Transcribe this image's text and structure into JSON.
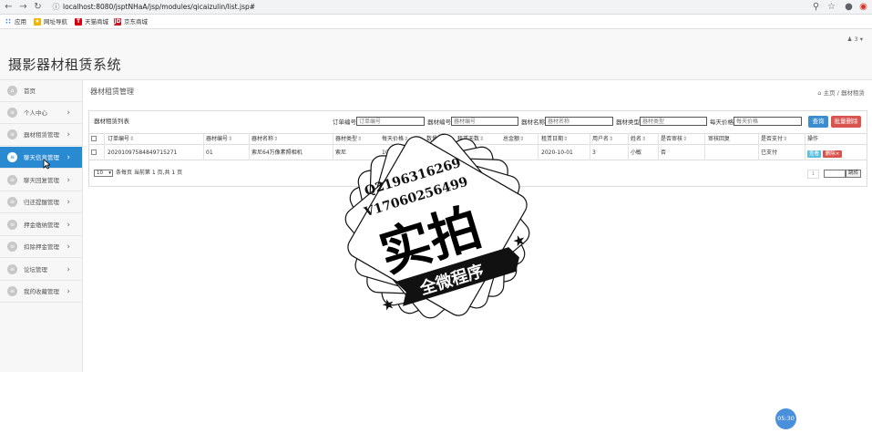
{
  "browser": {
    "url": "localhost:8080/jsptNHaA/jsp/modules/qicaizulin/list.jsp#",
    "bookmarks": [
      {
        "label": "应用",
        "icon": "apps-grid-icon"
      },
      {
        "label": "网址导航",
        "icon": "star-folder-icon"
      },
      {
        "label": "天猫商城",
        "icon": "tmall-icon"
      },
      {
        "label": "京东商城",
        "icon": "jd-icon"
      }
    ]
  },
  "header": {
    "app_title": "摄影器材租赁系统",
    "user_menu": "3"
  },
  "sidebar": {
    "items": [
      {
        "label": "首页",
        "active": false,
        "chevron": false
      },
      {
        "label": "个人中心",
        "active": false,
        "chevron": true
      },
      {
        "label": "器材租赁管理",
        "active": false,
        "chevron": true
      },
      {
        "label": "聊天信息管理",
        "active": true,
        "chevron": true
      },
      {
        "label": "聊天回复管理",
        "active": false,
        "chevron": true
      },
      {
        "label": "归还提醒管理",
        "active": false,
        "chevron": true
      },
      {
        "label": "押金缴纳管理",
        "active": false,
        "chevron": true
      },
      {
        "label": "扣除押金管理",
        "active": false,
        "chevron": true
      },
      {
        "label": "论坛管理",
        "active": false,
        "chevron": true
      },
      {
        "label": "我的收藏管理",
        "active": false,
        "chevron": true
      }
    ]
  },
  "main": {
    "heading": "器材租赁管理",
    "breadcrumb": {
      "home": "主页",
      "sep": "/",
      "current": "器材租赁"
    },
    "list_title": "器材租赁列表",
    "search": {
      "order_label": "订单编号",
      "order_placeholder": "订单编号",
      "equip_no_label": "器材编号",
      "equip_no_placeholder": "器材编号",
      "equip_name_label": "器材名称",
      "equip_name_placeholder": "器材名称",
      "equip_type_label": "器材类型",
      "equip_type_placeholder": "器材类型",
      "price_label": "每天价格",
      "price_placeholder": "每天价格",
      "query_button": "查询",
      "batch_delete_button": "批量删除"
    },
    "table": {
      "columns": [
        "订单编号",
        "器材编号",
        "器材名称",
        "器材类型",
        "每天价格",
        "数量",
        "租赁天数",
        "总金额",
        "租赁日期",
        "用户名",
        "姓名",
        "是否审核",
        "审核回复",
        "是否支付",
        "操作"
      ],
      "rows": [
        {
          "order_no": "20201097584849715271",
          "equip_no": "01",
          "equip_name": "索尼64万像素照相机",
          "equip_type": "索尼",
          "price": "100",
          "quantity": "2",
          "days": "10",
          "total": "",
          "date": "2020-10-01",
          "username": "3",
          "name": "小敏",
          "audited": "否",
          "reply": "",
          "paid": "已支付",
          "view_button": "查看",
          "delete_button": "删除"
        }
      ]
    },
    "pagination": {
      "page_size": "10",
      "info": "条每页 当前第 1 页,共 1 页",
      "current_page": "1",
      "jump_button": "跳转"
    }
  },
  "watermark": {
    "line1": "Q2196316269",
    "line2": "V17060256499",
    "big_text": "实拍",
    "ribbon_text": "全微程序"
  },
  "timer": "05:30",
  "colors": {
    "accent": "#2a8ad1",
    "query_button": "#3c8dce",
    "delete_button": "#d9534f",
    "view_button": "#5bc0de"
  }
}
